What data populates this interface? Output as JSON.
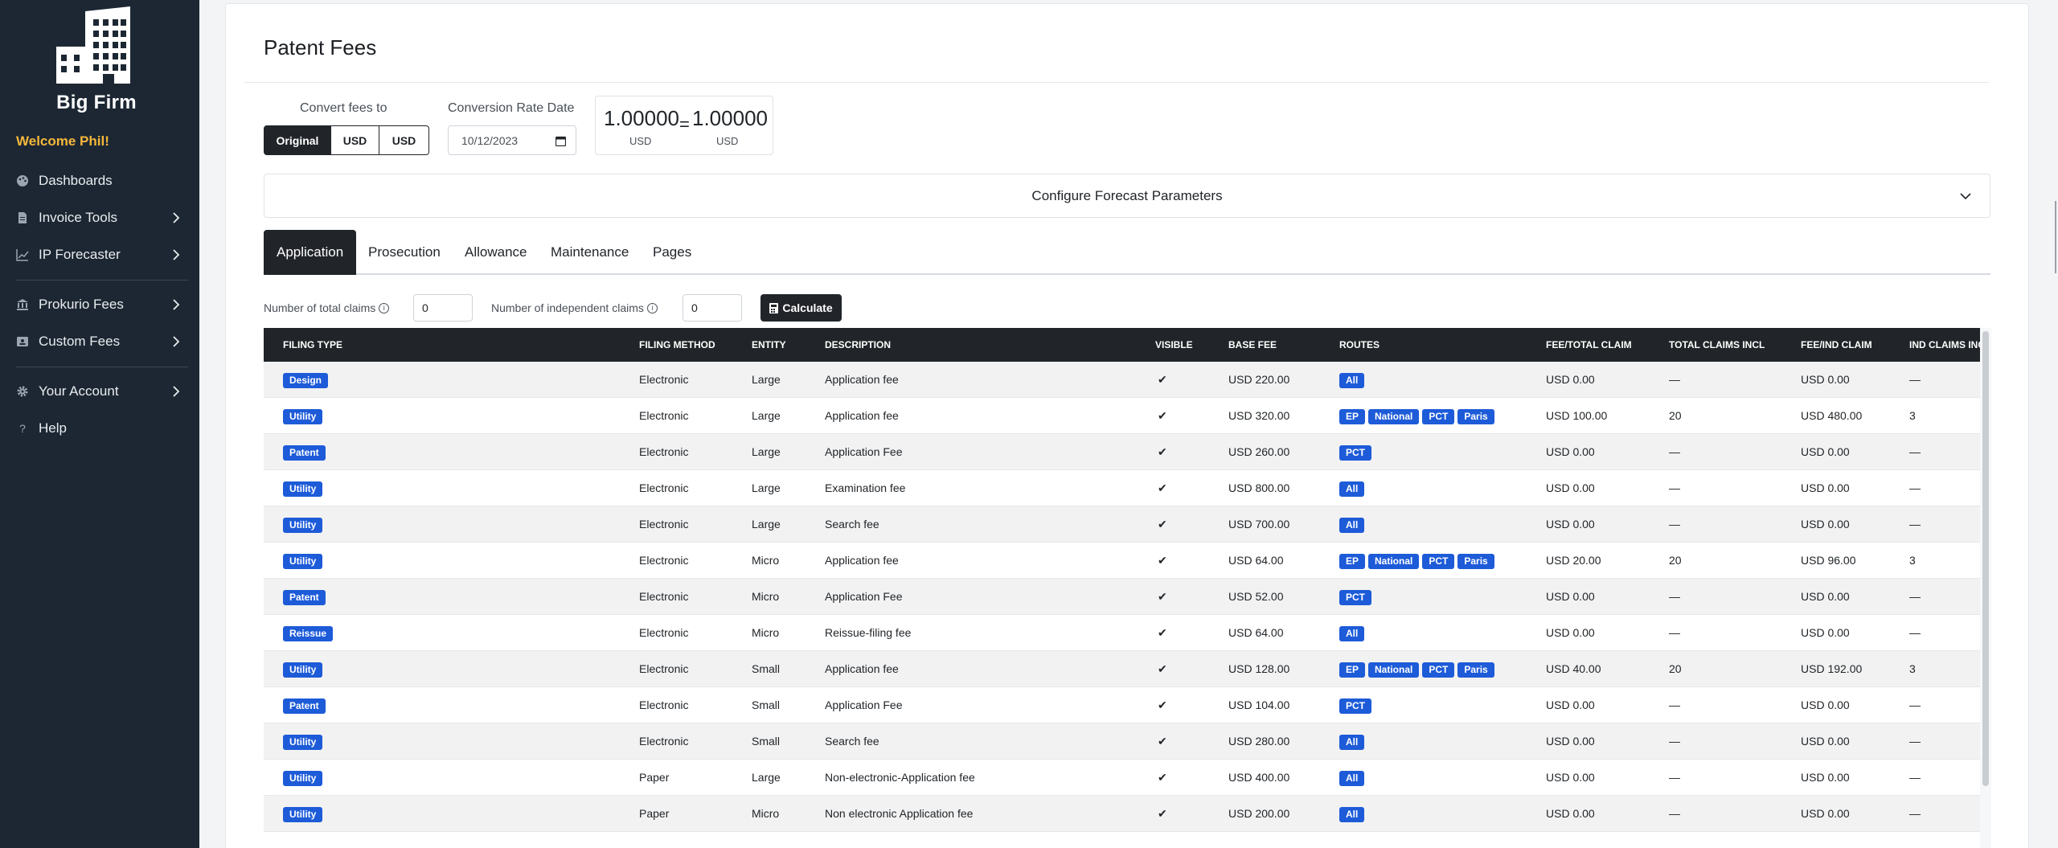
{
  "sidebar": {
    "brand": "Big Firm",
    "welcome": "Welcome Phil!",
    "items": [
      {
        "label": "Dashboards",
        "icon": "palette-icon",
        "has_chevron": false
      },
      {
        "label": "Invoice Tools",
        "icon": "document-icon",
        "has_chevron": true
      },
      {
        "label": "IP Forecaster",
        "icon": "chart-line-icon",
        "has_chevron": true
      },
      {
        "label": "Prokurio Fees",
        "icon": "bank-icon",
        "has_chevron": true
      },
      {
        "label": "Custom Fees",
        "icon": "id-card-icon",
        "has_chevron": true
      },
      {
        "label": "Your Account",
        "icon": "gear-icon",
        "has_chevron": true
      },
      {
        "label": "Help",
        "icon": "question-icon",
        "has_chevron": false
      }
    ]
  },
  "page": {
    "title": "Patent Fees"
  },
  "convert": {
    "label": "Convert fees to",
    "options": [
      "Original",
      "USD",
      "USD"
    ],
    "selected": "Original"
  },
  "conversion_date": {
    "label": "Conversion Rate Date",
    "value": "10/12/2023"
  },
  "rate": {
    "from_value": "1.00000",
    "from_currency": "USD",
    "equals": "=",
    "to_value": "1.00000",
    "to_currency": "USD"
  },
  "forecast": {
    "label": "Configure Forecast Parameters"
  },
  "tabs": [
    {
      "label": "Application",
      "active": true
    },
    {
      "label": "Prosecution",
      "active": false
    },
    {
      "label": "Allowance",
      "active": false
    },
    {
      "label": "Maintenance",
      "active": false
    },
    {
      "label": "Pages",
      "active": false
    }
  ],
  "claims": {
    "total_label": "Number of total claims",
    "total_value": "0",
    "independent_label": "Number of independent claims",
    "independent_value": "0",
    "calculate_label": "Calculate"
  },
  "table": {
    "columns": [
      "FILING TYPE",
      "FILING METHOD",
      "ENTITY",
      "DESCRIPTION",
      "VISIBLE",
      "BASE FEE",
      "ROUTES",
      "FEE/TOTAL CLAIM",
      "TOTAL CLAIMS INCL",
      "FEE/IND CLAIM",
      "IND CLAIMS INCL"
    ],
    "rows": [
      {
        "type": "Design",
        "method": "Electronic",
        "entity": "Large",
        "desc": "Application fee",
        "visible": "✔",
        "base": "USD 220.00",
        "routes": [
          "All"
        ],
        "fee_total": "USD 0.00",
        "total_incl": "—",
        "fee_ind": "USD 0.00",
        "ind_incl": "—"
      },
      {
        "type": "Utility",
        "method": "Electronic",
        "entity": "Large",
        "desc": "Application fee",
        "visible": "✔",
        "base": "USD 320.00",
        "routes": [
          "EP",
          "National",
          "PCT",
          "Paris"
        ],
        "fee_total": "USD 100.00",
        "total_incl": "20",
        "fee_ind": "USD 480.00",
        "ind_incl": "3"
      },
      {
        "type": "Patent",
        "method": "Electronic",
        "entity": "Large",
        "desc": "Application Fee",
        "visible": "✔",
        "base": "USD 260.00",
        "routes": [
          "PCT"
        ],
        "fee_total": "USD 0.00",
        "total_incl": "—",
        "fee_ind": "USD 0.00",
        "ind_incl": "—"
      },
      {
        "type": "Utility",
        "method": "Electronic",
        "entity": "Large",
        "desc": "Examination fee",
        "visible": "✔",
        "base": "USD 800.00",
        "routes": [
          "All"
        ],
        "fee_total": "USD 0.00",
        "total_incl": "—",
        "fee_ind": "USD 0.00",
        "ind_incl": "—"
      },
      {
        "type": "Utility",
        "method": "Electronic",
        "entity": "Large",
        "desc": "Search fee",
        "visible": "✔",
        "base": "USD 700.00",
        "routes": [
          "All"
        ],
        "fee_total": "USD 0.00",
        "total_incl": "—",
        "fee_ind": "USD 0.00",
        "ind_incl": "—"
      },
      {
        "type": "Utility",
        "method": "Electronic",
        "entity": "Micro",
        "desc": "Application fee",
        "visible": "✔",
        "base": "USD 64.00",
        "routes": [
          "EP",
          "National",
          "PCT",
          "Paris"
        ],
        "fee_total": "USD 20.00",
        "total_incl": "20",
        "fee_ind": "USD 96.00",
        "ind_incl": "3"
      },
      {
        "type": "Patent",
        "method": "Electronic",
        "entity": "Micro",
        "desc": "Application Fee",
        "visible": "✔",
        "base": "USD 52.00",
        "routes": [
          "PCT"
        ],
        "fee_total": "USD 0.00",
        "total_incl": "—",
        "fee_ind": "USD 0.00",
        "ind_incl": "—"
      },
      {
        "type": "Reissue",
        "method": "Electronic",
        "entity": "Micro",
        "desc": "Reissue-filing fee",
        "visible": "✔",
        "base": "USD 64.00",
        "routes": [
          "All"
        ],
        "fee_total": "USD 0.00",
        "total_incl": "—",
        "fee_ind": "USD 0.00",
        "ind_incl": "—"
      },
      {
        "type": "Utility",
        "method": "Electronic",
        "entity": "Small",
        "desc": "Application fee",
        "visible": "✔",
        "base": "USD 128.00",
        "routes": [
          "EP",
          "National",
          "PCT",
          "Paris"
        ],
        "fee_total": "USD 40.00",
        "total_incl": "20",
        "fee_ind": "USD 192.00",
        "ind_incl": "3"
      },
      {
        "type": "Patent",
        "method": "Electronic",
        "entity": "Small",
        "desc": "Application Fee",
        "visible": "✔",
        "base": "USD 104.00",
        "routes": [
          "PCT"
        ],
        "fee_total": "USD 0.00",
        "total_incl": "—",
        "fee_ind": "USD 0.00",
        "ind_incl": "—"
      },
      {
        "type": "Utility",
        "method": "Electronic",
        "entity": "Small",
        "desc": "Search fee",
        "visible": "✔",
        "base": "USD 280.00",
        "routes": [
          "All"
        ],
        "fee_total": "USD 0.00",
        "total_incl": "—",
        "fee_ind": "USD 0.00",
        "ind_incl": "—"
      },
      {
        "type": "Utility",
        "method": "Paper",
        "entity": "Large",
        "desc": "Non-electronic-Application fee",
        "visible": "✔",
        "base": "USD 400.00",
        "routes": [
          "All"
        ],
        "fee_total": "USD 0.00",
        "total_incl": "—",
        "fee_ind": "USD 0.00",
        "ind_incl": "—"
      },
      {
        "type": "Utility",
        "method": "Paper",
        "entity": "Micro",
        "desc": "Non electronic Application fee",
        "visible": "✔",
        "base": "USD 200.00",
        "routes": [
          "All"
        ],
        "fee_total": "USD 0.00",
        "total_incl": "—",
        "fee_ind": "USD 0.00",
        "ind_incl": "—"
      }
    ]
  },
  "colors": {
    "sidebar_bg": "#1c2733",
    "welcome": "#f5b73b",
    "badge": "#1d5bd8",
    "dark": "#212529"
  }
}
